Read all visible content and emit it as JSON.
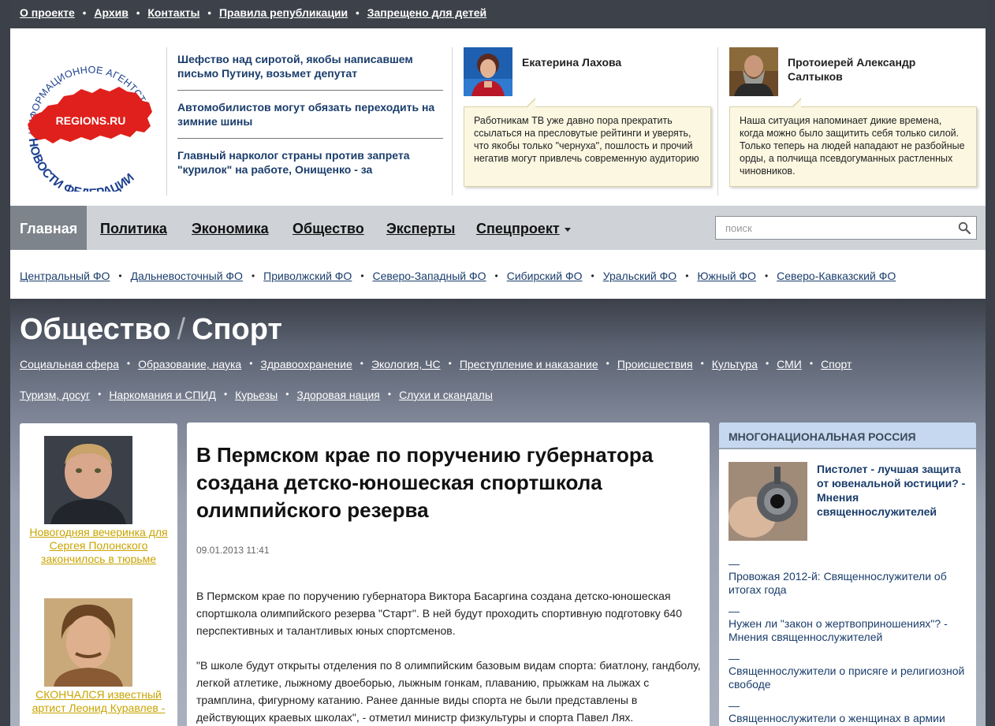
{
  "topnav": {
    "items": [
      "О проекте",
      "Архив",
      "Контакты",
      "Правила републикации",
      "Запрещено для детей"
    ],
    "separator": "•"
  },
  "logo": {
    "arc_text": "ИНФОРМАЦИОННОЕ АГЕНТСТВО",
    "brand": "REGIONS.RU",
    "bottom_text": "НОВОСТИ ФЕДЕРАЦИИ",
    "colors": {
      "map": "#e0201c",
      "text": "#1b3f8f"
    }
  },
  "header_news": [
    "Шефство над сиротой, якобы написавшем письмо Путину, возьмет депутат",
    "Автомобилистов могут обязать переходить на зимние шины",
    "Главный нарколог страны против запрета \"курилок\" на работе, Онищенко - за"
  ],
  "experts": [
    {
      "name": "Екатерина Лахова",
      "quote": "Работникам ТВ уже давно пора прекратить ссылаться на пресловутые рейтинги и уверять, что якобы только \"чернуха\", пошлость и прочий негатив могут привлечь современную аудиторию"
    },
    {
      "name": "Протоиерей Александр Салтыков",
      "quote": "Наша ситуация напоминает дикие времена, когда можно было защитить себя только силой. Только теперь на людей нападают не разбойные орды, а полчища псевдогуманных растленных чиновников."
    }
  ],
  "mainnav": {
    "items": [
      "Главная",
      "Политика",
      "Экономика",
      "Общество",
      "Эксперты",
      "Спецпроект"
    ],
    "active": "Главная"
  },
  "search": {
    "placeholder": "поиск",
    "icon": "magnifier-icon"
  },
  "regions": {
    "items": [
      "Центральный ФО",
      "Дальневосточный ФО",
      "Приволжский ФО",
      "Северо-Западный ФО",
      "Сибирский ФО",
      "Уральский ФО",
      "Южный ФО",
      "Северо-Кавказский ФО"
    ],
    "separator": "•"
  },
  "section": {
    "title": "Общество",
    "slash": "/",
    "subtitle": "Спорт",
    "subnav_row1": [
      "Социальная сфера",
      "Образование, наука",
      "Здравоохранение",
      "Экология, ЧС",
      "Преступление и наказание",
      "Происшествия",
      "Культура",
      "СМИ",
      "Спорт"
    ],
    "subnav_row2": [
      "Туризм, досуг",
      "Наркомания и СПИД",
      "Курьезы",
      "Здоровая нация",
      "Слухи и скандалы"
    ]
  },
  "left_column": [
    {
      "caption": "Новогодняя вечеринка для Сергея Полонского закончилось в тюрьме"
    },
    {
      "caption": "СКОНЧАЛСЯ известный артист Леонид Куравлев -"
    }
  ],
  "article": {
    "title": "В Пермском крае по поручению губернатора создана детско-юношеская спортшкола олимпийского резерва",
    "date": "09.01.2013 11:41",
    "paragraphs": [
      "В Пермском крае по поручению губернатора Виктора Басаргина создана детско-юношеская спортшкола олимпийского резерва \"Старт\". В ней будут проходить спортивную подготовку 640 перспективных и талантливых юных спортсменов.",
      "\"В школе будут открыты отделения по 8 олимпийским базовым видам спорта: биатлону, гандболу, легкой атлетике, лыжному двоеборью, лыжным гонкам, плаванию, прыжкам на лыжах с трамплина, фигурному катанию. Ранее данные виды спорта не были представлены в действующих краевых школах\", - отметил министр физкультуры и спорта Павел Лях."
    ]
  },
  "right_column": {
    "heading": "МНОГОНАЦИОНАЛЬНАЯ РОССИЯ",
    "lead": "Пистолет - лучшая защита от ювенальной юстиции? - Мнения священнослужителей",
    "dash": "—",
    "items": [
      "Провожая 2012-й: Священнослужители об итогах года",
      "Нужен ли \"закон о жертвоприношениях\"? - Мнения священнослужителей",
      "Священнослужители о присяге и религиозной свободе",
      "Священнослужители о женщинах в армии"
    ]
  }
}
